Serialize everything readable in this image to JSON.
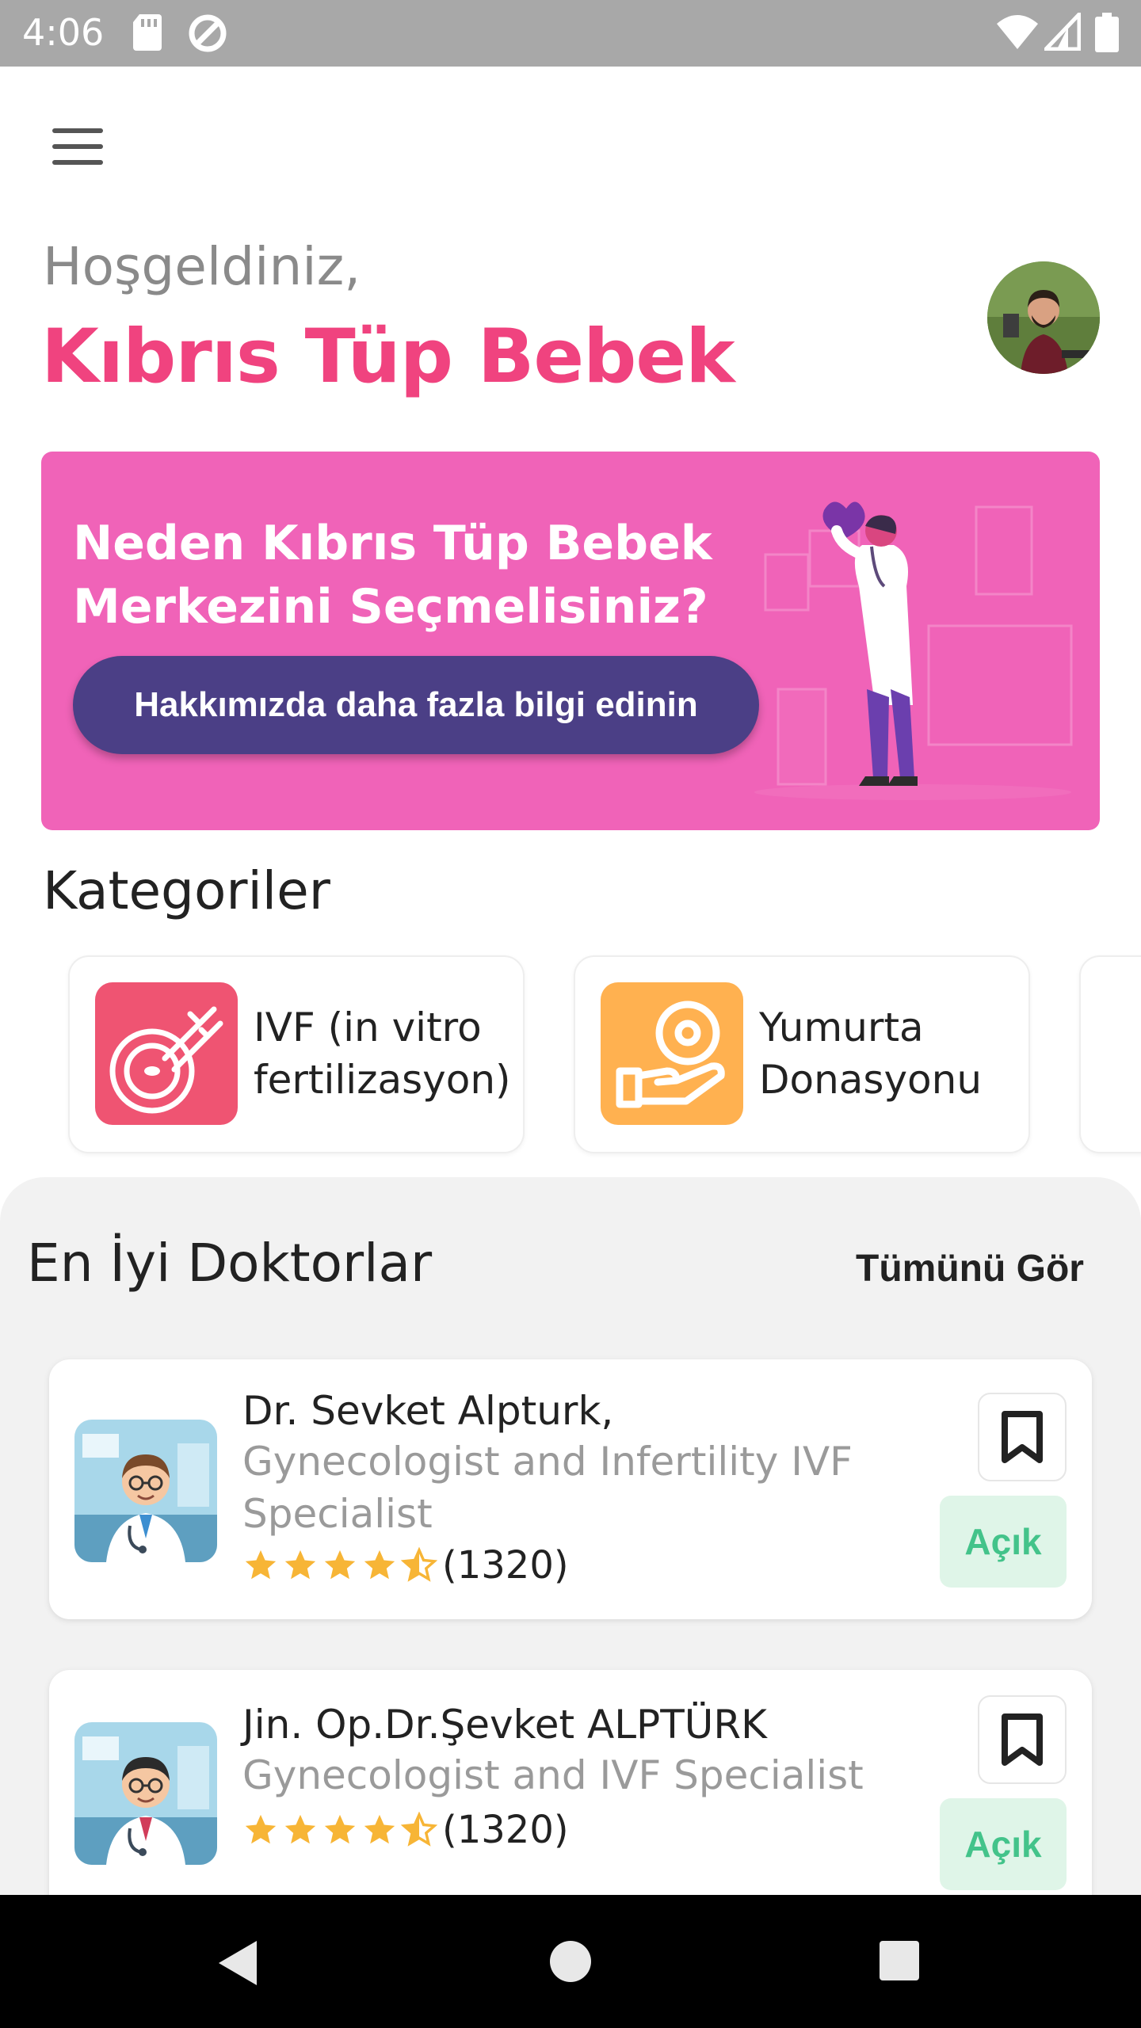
{
  "status_bar": {
    "time": "4:06",
    "icons": [
      "sd-card-icon",
      "sync-icon",
      "wifi-icon",
      "signal-icon",
      "battery-icon"
    ]
  },
  "header": {
    "menu_icon": "hamburger-menu-icon",
    "greeting": "Hoşgeldiniz,",
    "brand": "Kıbrıs Tüp Bebek",
    "avatar": "profile-avatar"
  },
  "banner": {
    "title": "Neden Kıbrıs Tüp Bebek Merkezini Seçmelisiniz?",
    "button_label": "Hakkımızda daha fazla bilgi edinin",
    "background": "#f063b8",
    "button_color": "#4b3f86"
  },
  "categories": {
    "title": "Kategoriler",
    "items": [
      {
        "label": "IVF (in vitro fertilizasyon)",
        "icon": "ivf-icon",
        "color": "#ef5472"
      },
      {
        "label": "Yumurta Donasyonu",
        "icon": "egg-donation-icon",
        "color": "#ffb150"
      }
    ]
  },
  "doctors": {
    "title": "En İyi Doktorlar",
    "see_all": "Tümünü Gör",
    "items": [
      {
        "name": "Dr. Sevket Alpturk,",
        "specialty": "Gynecologist and Infertility IVF Specialist",
        "rating": 4.5,
        "reviews": "(1320)",
        "status": "Açık"
      },
      {
        "name": "Jin. Op.Dr.Şevket ALPTÜRK",
        "specialty": "Gynecologist and IVF Specialist",
        "rating": 4.5,
        "reviews": "(1320)",
        "status": "Açık"
      }
    ]
  },
  "colors": {
    "accent": "#f0437f",
    "star": "#f7b536",
    "open_text": "#43c38a",
    "open_bg": "#dff5e8"
  },
  "nav_bar": {
    "buttons": [
      "back-icon",
      "home-icon",
      "recents-icon"
    ]
  }
}
